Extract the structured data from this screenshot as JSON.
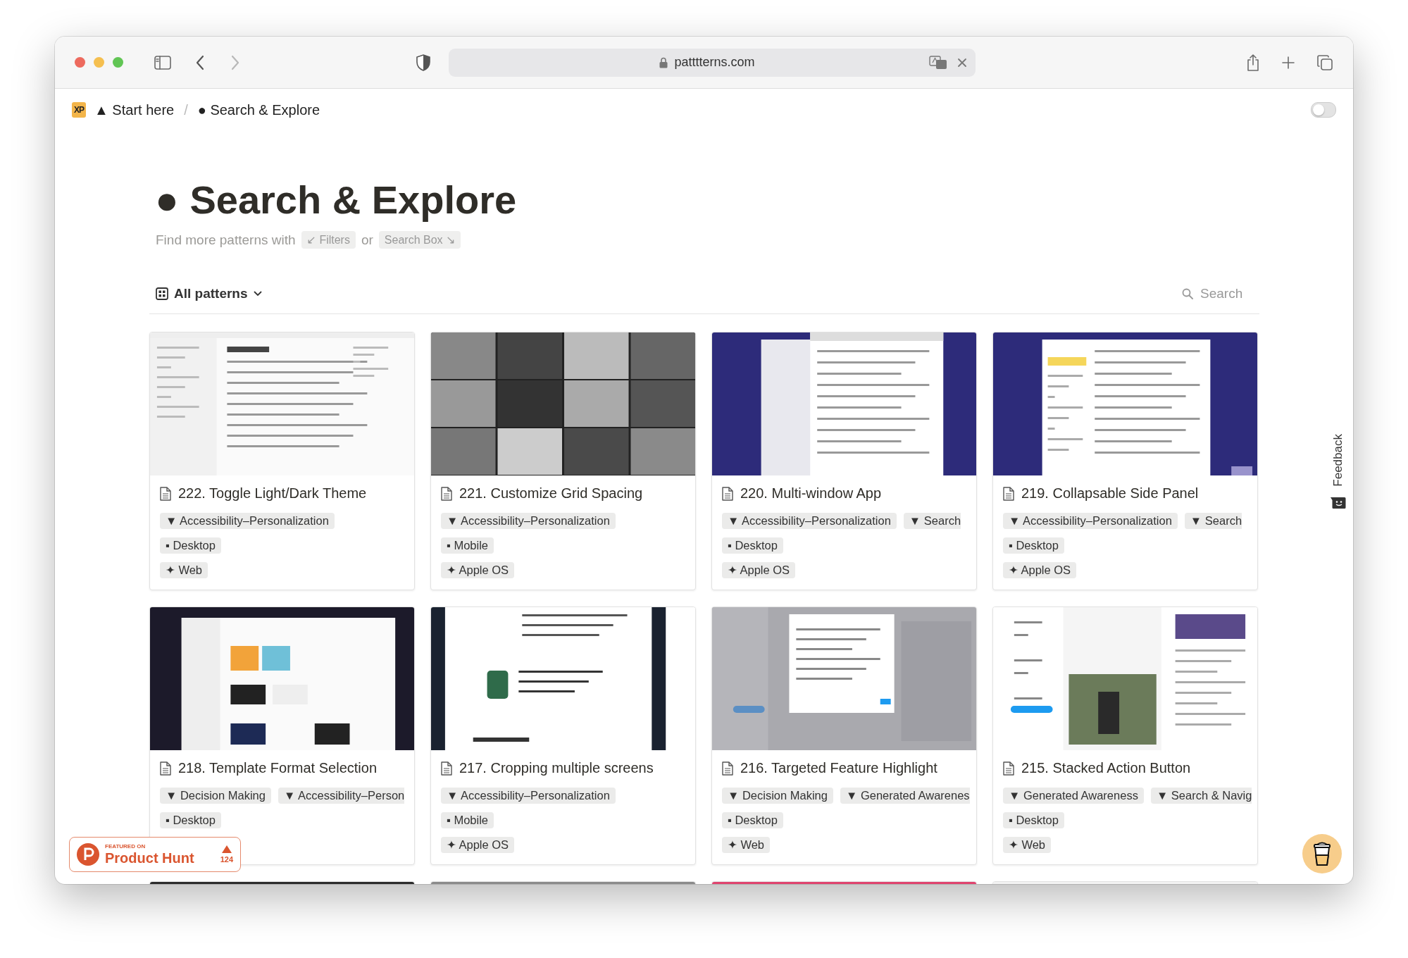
{
  "browser": {
    "url": "patttterns.com"
  },
  "breadcrumb": {
    "logo": "XP",
    "items": [
      "▲ Start here",
      "● Search & Explore"
    ],
    "separator": "/"
  },
  "theme_toggle": {
    "on": false
  },
  "page": {
    "title": "● Search & Explore",
    "subtitle": [
      {
        "kind": "text",
        "text": "Find more patterns with"
      },
      {
        "kind": "chip",
        "text": "↙ Filters"
      },
      {
        "kind": "text",
        "text": "or"
      },
      {
        "kind": "chip",
        "text": "Search Box ↘"
      }
    ]
  },
  "view": {
    "label": "All patterns",
    "search_placeholder": "Search"
  },
  "cards": [
    {
      "thumb": {
        "kind": "picture"
      },
      "title": "222. Toggle Light/Dark Theme",
      "tag_rows": [
        [
          "▼ Accessibility–Personalization"
        ],
        [
          "▪ Desktop"
        ],
        [
          "✦ Web"
        ]
      ]
    },
    {
      "thumb": {
        "kind": "picture"
      },
      "title": "221. Customize Grid Spacing",
      "tag_rows": [
        [
          "▼ Accessibility–Personalization"
        ],
        [
          "▪ Mobile"
        ],
        [
          "✦ Apple OS"
        ]
      ]
    },
    {
      "thumb": {
        "kind": "picture"
      },
      "title": "220. Multi-window App",
      "tag_rows": [
        [
          "▼ Accessibility–Personalization",
          "▼ Search"
        ],
        [
          "▪ Desktop"
        ],
        [
          "✦ Apple OS"
        ]
      ]
    },
    {
      "thumb": {
        "kind": "picture"
      },
      "title": "219. Collapsable Side Panel",
      "tag_rows": [
        [
          "▼ Accessibility–Personalization",
          "▼ Search"
        ],
        [
          "▪ Desktop"
        ],
        [
          "✦ Apple OS"
        ]
      ]
    },
    {
      "thumb": {
        "kind": "picture"
      },
      "title": "218. Template Format Selection",
      "tag_rows": [
        [
          "▼ Decision Making",
          "▼ Accessibility–Person"
        ],
        [
          "▪ Desktop"
        ]
      ]
    },
    {
      "thumb": {
        "kind": "picture"
      },
      "title": "217. Cropping multiple screens",
      "tag_rows": [
        [
          "▼ Accessibility–Personalization"
        ],
        [
          "▪ Mobile"
        ],
        [
          "✦ Apple OS"
        ]
      ]
    },
    {
      "thumb": {
        "kind": "picture"
      },
      "title": "216. Targeted Feature Highlight",
      "tag_rows": [
        [
          "▼ Decision Making",
          "▼ Generated Awarenes"
        ],
        [
          "▪ Desktop"
        ],
        [
          "✦ Web"
        ]
      ]
    },
    {
      "thumb": {
        "kind": "picture"
      },
      "title": "215. Stacked Action Button",
      "tag_rows": [
        [
          "▼ Generated Awareness",
          "▼ Search & Navig"
        ],
        [
          "▪ Desktop"
        ],
        [
          "✦ Web"
        ]
      ]
    }
  ],
  "peek_row": [
    {
      "kind": "picture"
    },
    {
      "kind": "picture"
    },
    {
      "kind": "picture"
    },
    {
      "kind": "picture"
    }
  ],
  "feedback": {
    "label": "Feedback"
  },
  "product_hunt": {
    "eyebrow": "FEATURED ON",
    "name": "Product Hunt",
    "votes": "124"
  }
}
